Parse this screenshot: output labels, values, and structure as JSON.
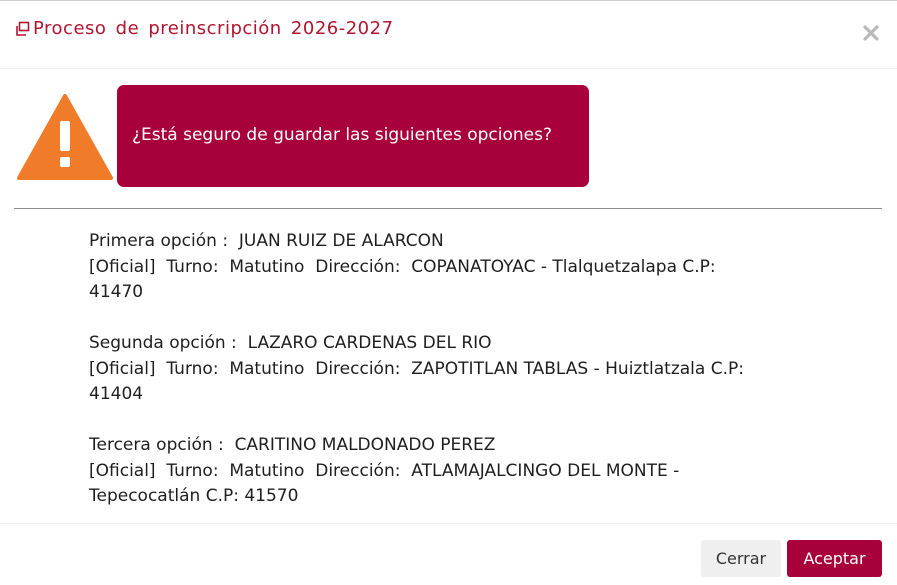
{
  "header": {
    "title": "Proceso de preinscripción 2026-2027",
    "title_icon": "window-restore-icon",
    "close_icon": "close-icon"
  },
  "alert": {
    "icon": "warning-triangle-icon",
    "message": "¿Está seguro de guardar las siguientes opciones?"
  },
  "options": [
    {
      "label": "Primera opción :  JUAN RUIZ DE ALARCON",
      "details": "[Oficial]  Turno:  Matutino  Dirección:  COPANATOYAC - Tlalquetzalapa C.P:",
      "details_cont": "41470"
    },
    {
      "label": "Segunda opción :  LAZARO CARDENAS DEL RIO",
      "details": "[Oficial]  Turno:  Matutino  Dirección:  ZAPOTITLAN TABLAS - Huiztlatzala C.P:",
      "details_cont": "41404"
    },
    {
      "label": "Tercera opción :  CARITINO MALDONADO PEREZ",
      "details": "[Oficial]  Turno:  Matutino  Dirección:  ATLAMAJALCINGO DEL MONTE -",
      "details_cont": "Tepecocatlán C.P: 41570"
    }
  ],
  "footer": {
    "cancel_label": "Cerrar",
    "ok_label": "Aceptar"
  },
  "colors": {
    "accent": "#a8003b",
    "title": "#b0142f",
    "warning": "#f07c2a"
  }
}
